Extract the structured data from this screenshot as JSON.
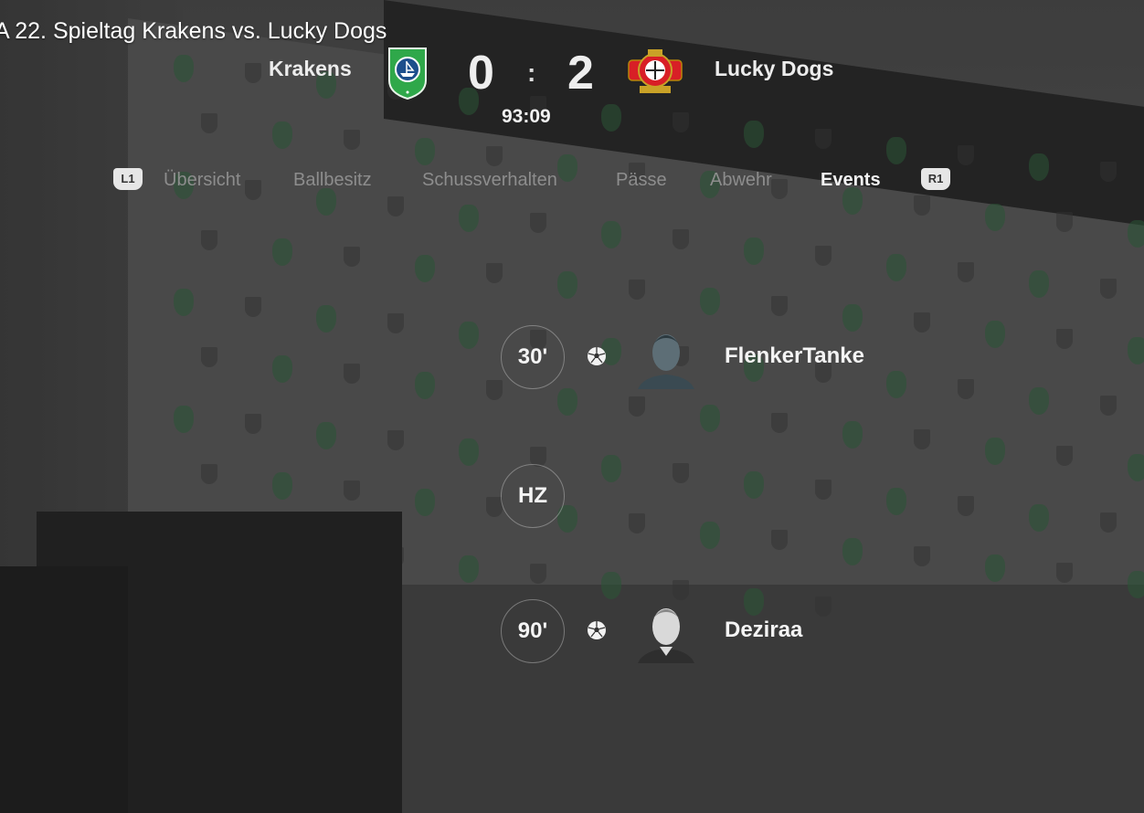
{
  "video_title": "A 22. Spieltag Krakens vs. Lucky Dogs",
  "match": {
    "home_team": "Krakens",
    "away_team": "Lucky Dogs",
    "home_score": "0",
    "away_score": "2",
    "separator": ":",
    "clock": "93:09"
  },
  "tabs": {
    "left_hint": "L1",
    "right_hint": "R1",
    "items": [
      {
        "label": "Übersicht"
      },
      {
        "label": "Ballbesitz"
      },
      {
        "label": "Schussverhalten"
      },
      {
        "label": "Pässe"
      },
      {
        "label": "Abwehr"
      },
      {
        "label": "Events"
      }
    ],
    "active": "Events"
  },
  "events": [
    {
      "minute": "30'",
      "type": "goal",
      "icon": "soccer-ball-icon",
      "player": "FlenkerTanke"
    },
    {
      "minute": "HZ",
      "type": "halftime"
    },
    {
      "minute": "90'",
      "type": "goal",
      "icon": "soccer-ball-icon",
      "player": "Deziraa"
    }
  ],
  "colors": {
    "active_tab": "#f4f4f4",
    "inactive_tab": "#8d8d8d",
    "home_crest": "#2fa84a",
    "away_crest": "#d81f26"
  }
}
